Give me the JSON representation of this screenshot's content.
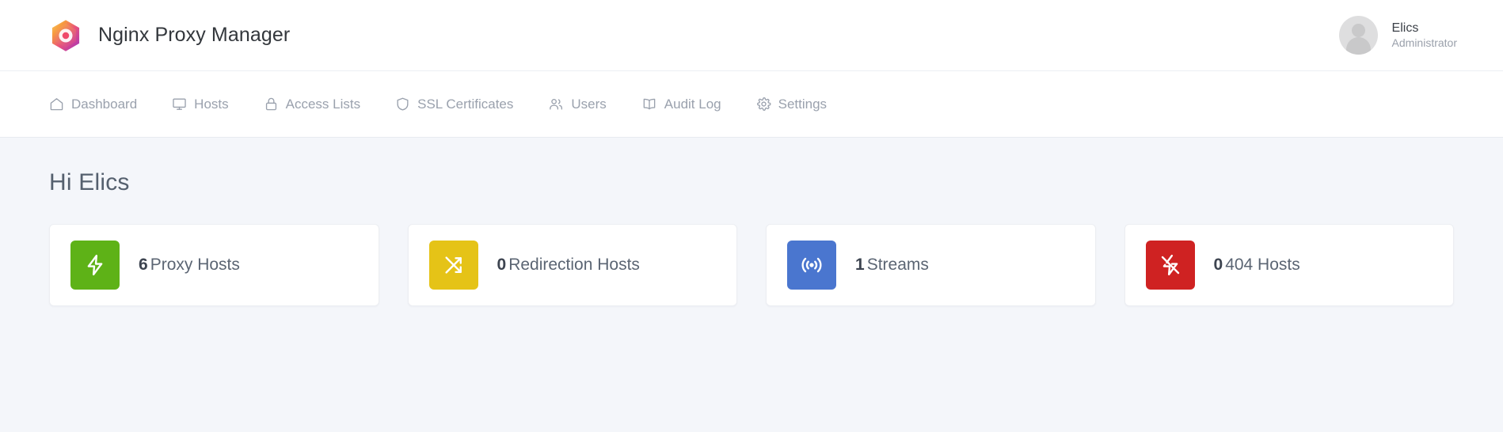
{
  "header": {
    "logo_icon": "nginx-proxy-manager-hexagon-logo",
    "title": "Nginx Proxy Manager",
    "user": {
      "avatar_icon": "user-avatar-placeholder",
      "name": "Elics",
      "role": "Administrator"
    }
  },
  "nav": {
    "items": [
      {
        "label": "Dashboard",
        "icon": "home-icon"
      },
      {
        "label": "Hosts",
        "icon": "monitor-icon"
      },
      {
        "label": "Access Lists",
        "icon": "lock-icon"
      },
      {
        "label": "SSL Certificates",
        "icon": "shield-icon"
      },
      {
        "label": "Users",
        "icon": "users-icon"
      },
      {
        "label": "Audit Log",
        "icon": "book-icon"
      },
      {
        "label": "Settings",
        "icon": "gear-icon"
      }
    ]
  },
  "main": {
    "greeting": "Hi Elics",
    "stats": [
      {
        "count": "6",
        "label": "Proxy Hosts",
        "icon": "bolt-icon",
        "color": "#5eb217"
      },
      {
        "count": "0",
        "label": "Redirection Hosts",
        "icon": "shuffle-icon",
        "color": "#e5c317"
      },
      {
        "count": "1",
        "label": "Streams",
        "icon": "broadcast-icon",
        "color": "#4a76cf"
      },
      {
        "count": "0",
        "label": "404 Hosts",
        "icon": "bolt-off-icon",
        "color": "#cf2222"
      }
    ]
  }
}
